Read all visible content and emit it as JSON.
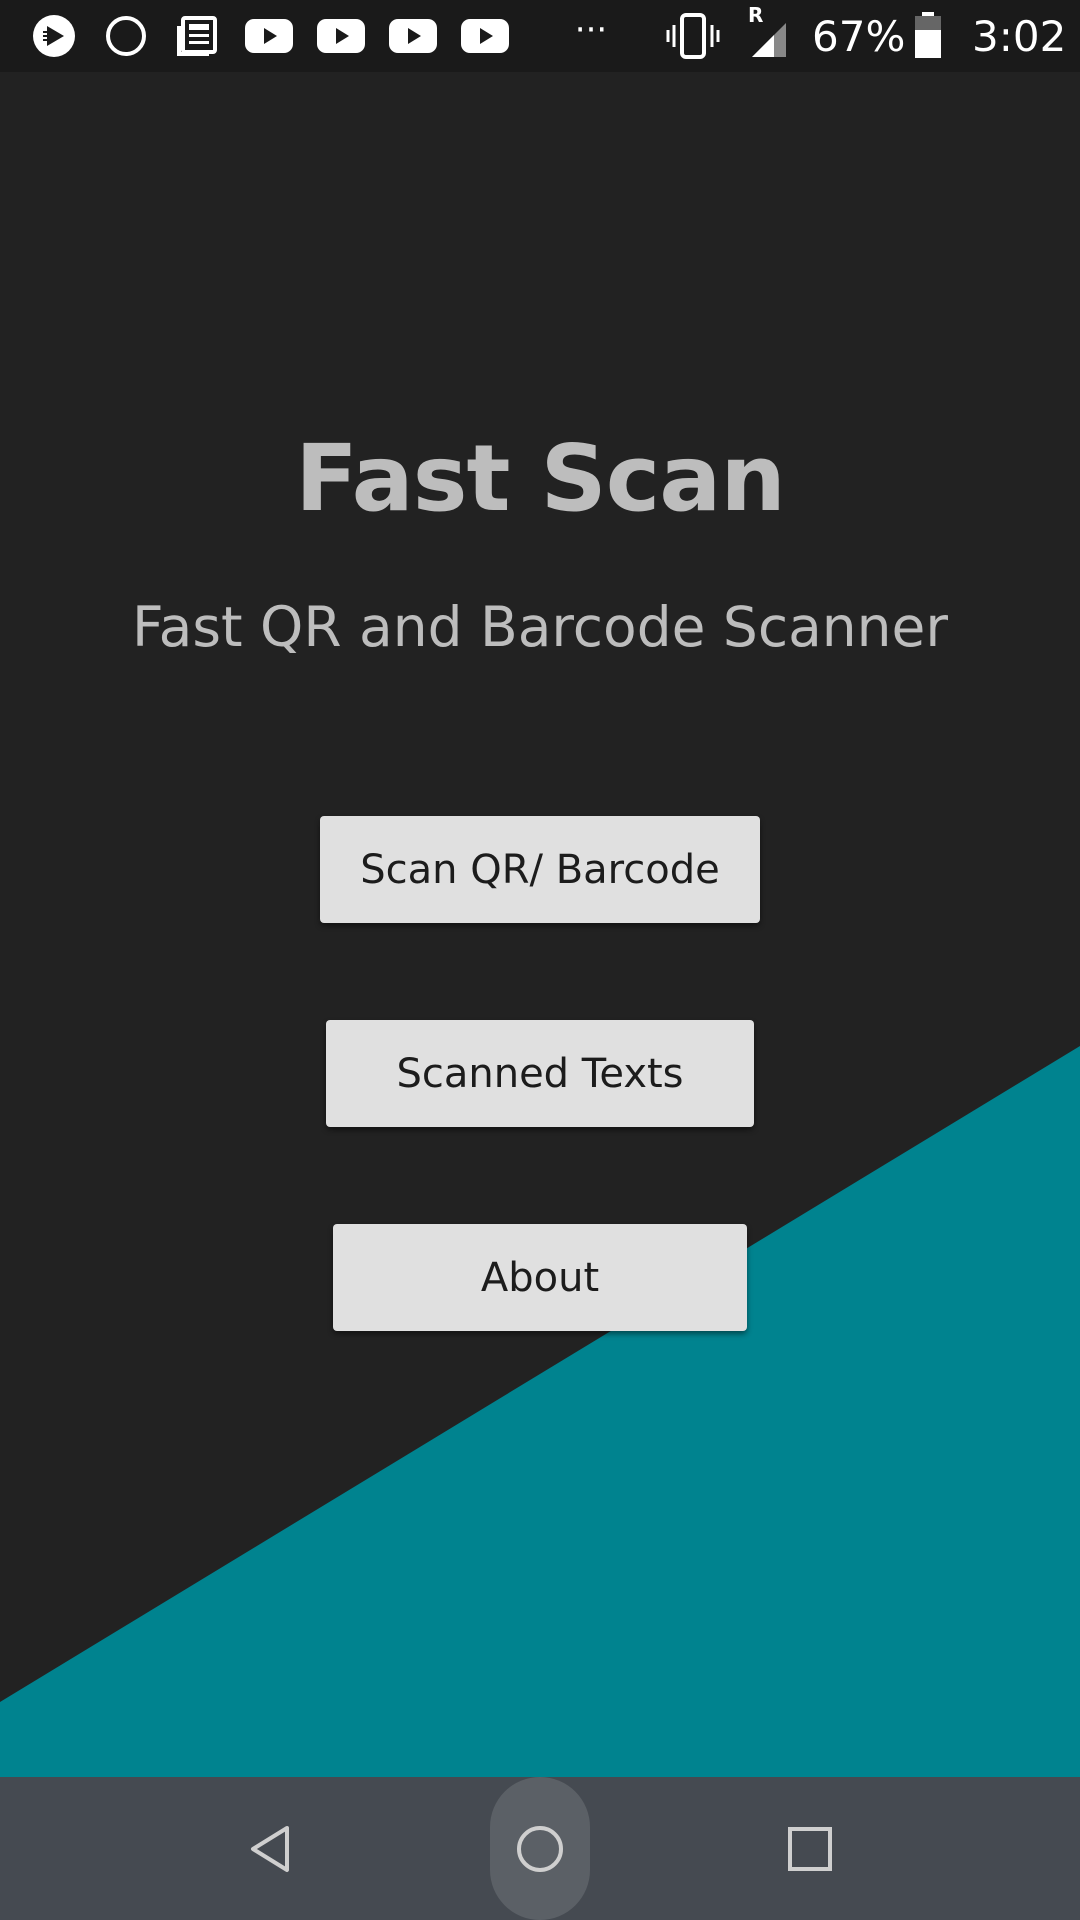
{
  "status_bar": {
    "icons_left": [
      "play-store-notification-icon",
      "circle-notification-icon",
      "news-notification-icon",
      "youtube-notification-icon",
      "youtube-notification-icon",
      "youtube-notification-icon",
      "youtube-notification-icon"
    ],
    "overflow": "···",
    "roaming_indicator": "R",
    "battery_percent": "67%",
    "time": "3:02",
    "battery_level": 0.67
  },
  "app": {
    "title": "Fast Scan",
    "subtitle": "Fast QR and Barcode Scanner"
  },
  "buttons": {
    "scan": "Scan QR/ Barcode",
    "scanned_texts": "Scanned Texts",
    "about": "About"
  },
  "colors": {
    "background": "#222222",
    "accent_teal": "#00838f",
    "button_bg": "#e0e0e0",
    "title_text": "#bdbdbd",
    "nav_bar": "#454a51"
  },
  "nav_bar": {
    "icons": [
      "back-icon",
      "home-icon",
      "recents-icon"
    ]
  }
}
